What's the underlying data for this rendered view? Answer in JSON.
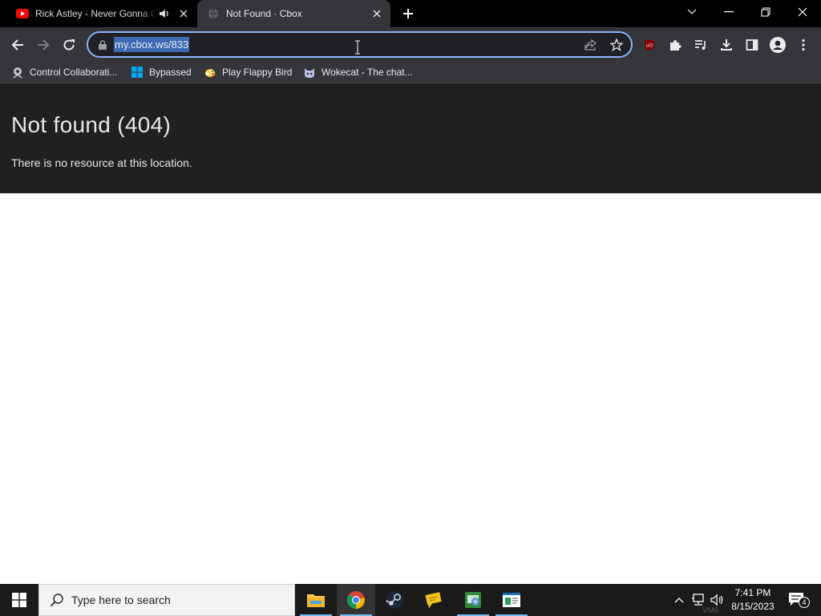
{
  "browser": {
    "tabs": [
      {
        "title": "Rick Astley - Never Gonna Give You Up",
        "favicon": "youtube-icon",
        "audio": "speaker-icon",
        "active": false
      },
      {
        "title": "Not Found · Cbox",
        "favicon": "globe-icon",
        "active": true
      }
    ],
    "address": {
      "url": "my.cbox.ws/833",
      "selected": true
    },
    "bookmarks": [
      {
        "label": "Control Collaborati...",
        "icon": "gear-badge-icon"
      },
      {
        "label": "Bypassed",
        "icon": "windows-icon"
      },
      {
        "label": "Play Flappy Bird",
        "icon": "flappy-bird-icon"
      },
      {
        "label": "Wokecat - The chat...",
        "icon": "cat-icon"
      }
    ],
    "extensions": [
      "ublock-icon",
      "puzzle-icon",
      "media-queue-icon"
    ],
    "colors": {
      "tabstrip": "#000000",
      "toolbar": "#35363a",
      "focus": "#8ab4f8",
      "url_selection": "#3e69b3"
    }
  },
  "page": {
    "title": "Not found (404)",
    "message": "There is no resource at this location.",
    "colors": {
      "header_bg": "#202020",
      "text": "#e8e8e8"
    }
  },
  "taskbar": {
    "search_placeholder": "Type here to search",
    "apps": [
      "file-explorer-icon",
      "chrome-icon",
      "steam-icon",
      "chat-app-icon",
      "vm-app-icon",
      "document-app-icon"
    ],
    "clock": {
      "time": "7:41 PM",
      "date": "8/15/2023"
    },
    "notifications": "4",
    "watermark": "VM6"
  }
}
